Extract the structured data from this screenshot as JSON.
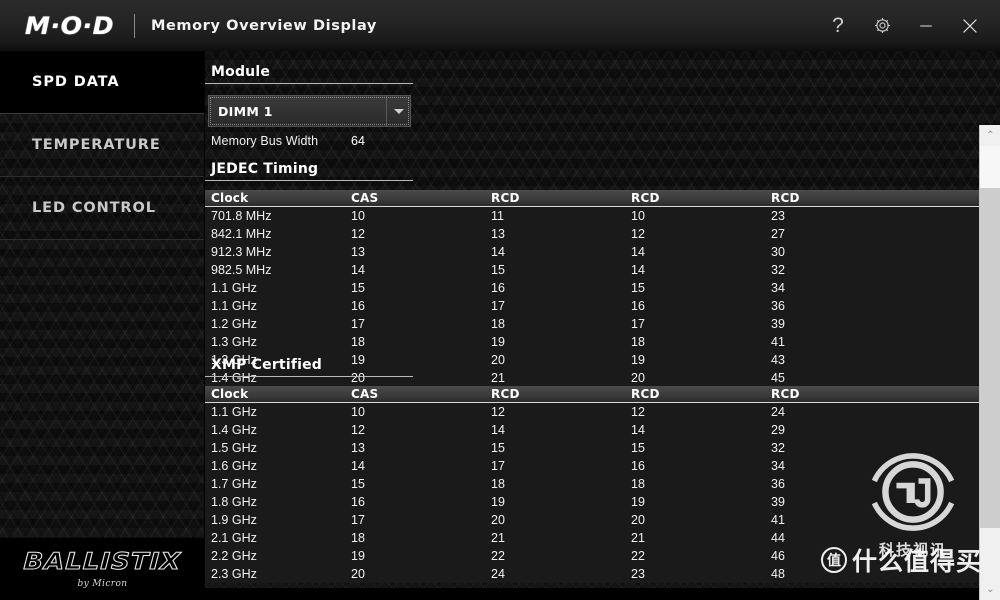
{
  "header": {
    "logo": "M·O·D",
    "subtitle": "Memory Overview Display",
    "controls": [
      {
        "name": "help-button",
        "glyph": "?"
      },
      {
        "name": "settings-button",
        "glyph": "gear-icon"
      },
      {
        "name": "minimize-button",
        "glyph": "—"
      },
      {
        "name": "close-button",
        "glyph": "✕"
      }
    ]
  },
  "sidebar": {
    "items": [
      {
        "label": "SPD DATA",
        "active": true
      },
      {
        "label": "TEMPERATURE",
        "active": false
      },
      {
        "label": "LED CONTROL",
        "active": false
      }
    ],
    "logo": {
      "word": "BALLISTIX",
      "sub": "by Micron"
    }
  },
  "main": {
    "module_section": {
      "heading": "Module",
      "select": {
        "value": "DIMM 1",
        "options": [
          "DIMM 1"
        ]
      },
      "bus_width_label": "Memory Bus Width",
      "bus_width_value": "64"
    },
    "jedec": {
      "heading": "JEDEC Timing",
      "columns": [
        "Clock",
        "CAS",
        "RCD",
        "RCD",
        "RCD"
      ],
      "rows": [
        [
          "701.8 MHz",
          "10",
          "11",
          "10",
          "23"
        ],
        [
          "842.1 MHz",
          "12",
          "13",
          "12",
          "27"
        ],
        [
          "912.3 MHz",
          "13",
          "14",
          "14",
          "30"
        ],
        [
          "982.5 MHz",
          "14",
          "15",
          "14",
          "32"
        ],
        [
          "1.1 GHz",
          "15",
          "16",
          "15",
          "34"
        ],
        [
          "1.1 GHz",
          "16",
          "17",
          "16",
          "36"
        ],
        [
          "1.2 GHz",
          "17",
          "18",
          "17",
          "39"
        ],
        [
          "1.3 GHz",
          "18",
          "19",
          "18",
          "41"
        ],
        [
          "1.3 GHz",
          "19",
          "20",
          "19",
          "43"
        ],
        [
          "1.4 GHz",
          "20",
          "21",
          "20",
          "45"
        ]
      ]
    },
    "xmp": {
      "heading": "XMP Certified",
      "columns": [
        "Clock",
        "CAS",
        "RCD",
        "RCD",
        "RCD"
      ],
      "rows": [
        [
          "1.1 GHz",
          "10",
          "12",
          "12",
          "24"
        ],
        [
          "1.4 GHz",
          "12",
          "14",
          "14",
          "29"
        ],
        [
          "1.5 GHz",
          "13",
          "15",
          "15",
          "32"
        ],
        [
          "1.6 GHz",
          "14",
          "17",
          "16",
          "34"
        ],
        [
          "1.7 GHz",
          "15",
          "18",
          "18",
          "36"
        ],
        [
          "1.8 GHz",
          "16",
          "19",
          "19",
          "39"
        ],
        [
          "1.9 GHz",
          "17",
          "20",
          "20",
          "41"
        ],
        [
          "2.1 GHz",
          "18",
          "21",
          "21",
          "44"
        ],
        [
          "2.2 GHz",
          "19",
          "22",
          "22",
          "46"
        ],
        [
          "2.3 GHz",
          "20",
          "24",
          "23",
          "48"
        ]
      ]
    }
  },
  "scrollbar": {
    "up_arrow": "⌃",
    "down_arrow": "⌄"
  },
  "watermarks": {
    "tv_site": "科技视讯",
    "smzdm_badge": "值",
    "smzdm_text": "什么值得买"
  },
  "colors": {
    "background": "#121212",
    "header": "#242424",
    "accent_text": "#ffffff",
    "table_row": "#1a1a1a",
    "scrollbar": "#f0f0f0"
  }
}
